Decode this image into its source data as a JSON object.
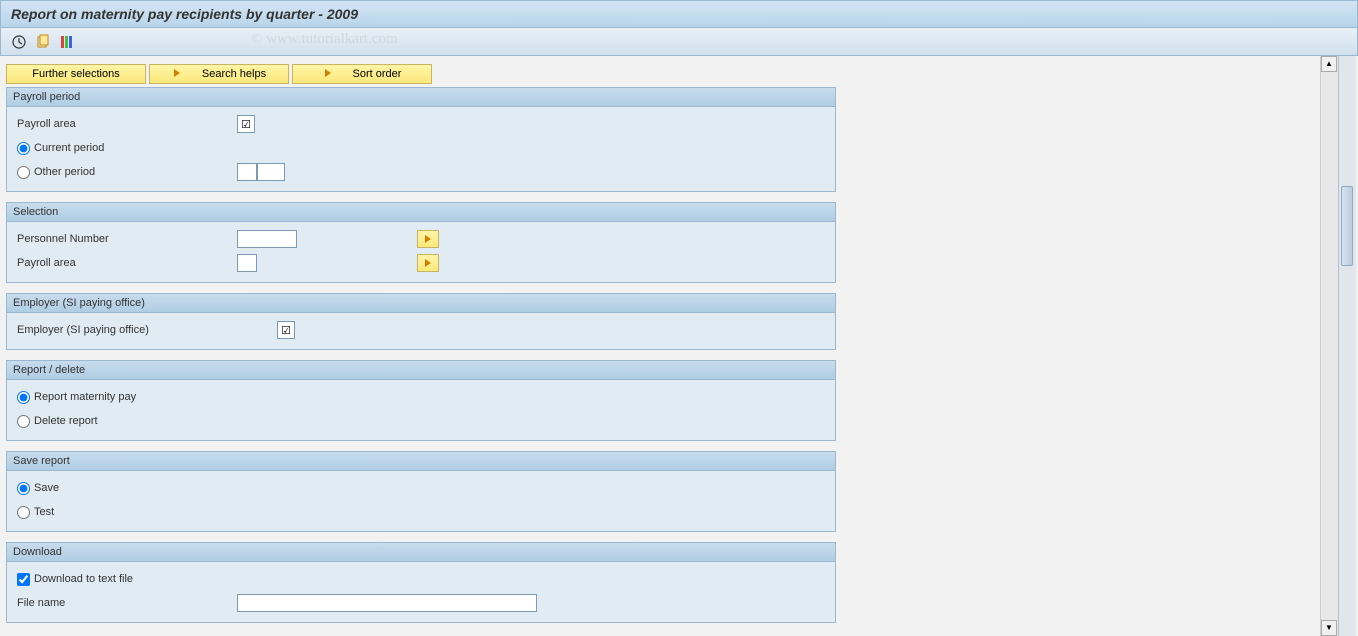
{
  "title": "Report on maternity pay recipients by quarter - 2009",
  "watermark": "© www.tutorialkart.com",
  "buttons": {
    "further_selections": "Further selections",
    "search_helps": "Search helps",
    "sort_order": "Sort order"
  },
  "groups": {
    "payroll_period": {
      "title": "Payroll period",
      "payroll_area": "Payroll area",
      "current_period": "Current period",
      "other_period": "Other period"
    },
    "selection": {
      "title": "Selection",
      "personnel_number": "Personnel Number",
      "payroll_area": "Payroll area"
    },
    "employer": {
      "title": "Employer (SI paying office)",
      "label": "Employer (SI paying office)"
    },
    "report_delete": {
      "title": "Report / delete",
      "report": "Report maternity pay",
      "delete": "Delete report"
    },
    "save_report": {
      "title": "Save report",
      "save": "Save",
      "test": "Test"
    },
    "download": {
      "title": "Download",
      "download_file": "Download to text file",
      "file_name": "File name"
    }
  }
}
